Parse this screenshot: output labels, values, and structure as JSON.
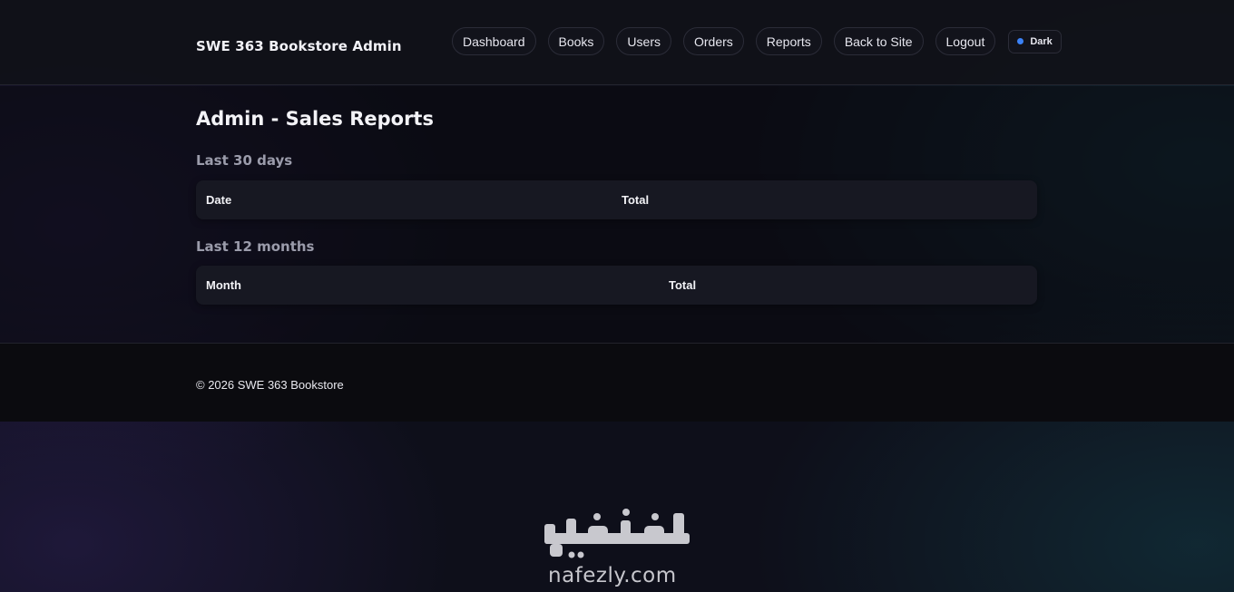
{
  "header": {
    "brand": "SWE 363 Bookstore Admin",
    "nav": [
      {
        "label": "Dashboard"
      },
      {
        "label": "Books"
      },
      {
        "label": "Users"
      },
      {
        "label": "Orders"
      },
      {
        "label": "Reports"
      },
      {
        "label": "Back to Site"
      },
      {
        "label": "Logout"
      }
    ],
    "theme_toggle": {
      "label": "Dark",
      "dot_color": "#3b82f6"
    }
  },
  "main": {
    "title": "Admin - Sales Reports",
    "daily": {
      "heading": "Last 30 days",
      "columns": [
        "Date",
        "Total"
      ]
    },
    "monthly": {
      "heading": "Last 12 months",
      "columns": [
        "Month",
        "Total"
      ]
    }
  },
  "footer": {
    "copyright": "© 2026 SWE 363 Bookstore"
  },
  "watermark": {
    "arabic": "نفذلي",
    "latin": "nafezly.com"
  },
  "colors": {
    "background": "#0e0f1a",
    "header": "#101118",
    "table_header": "#171822",
    "section_heading": "#9b9cab",
    "accent": "#3b82f6"
  }
}
